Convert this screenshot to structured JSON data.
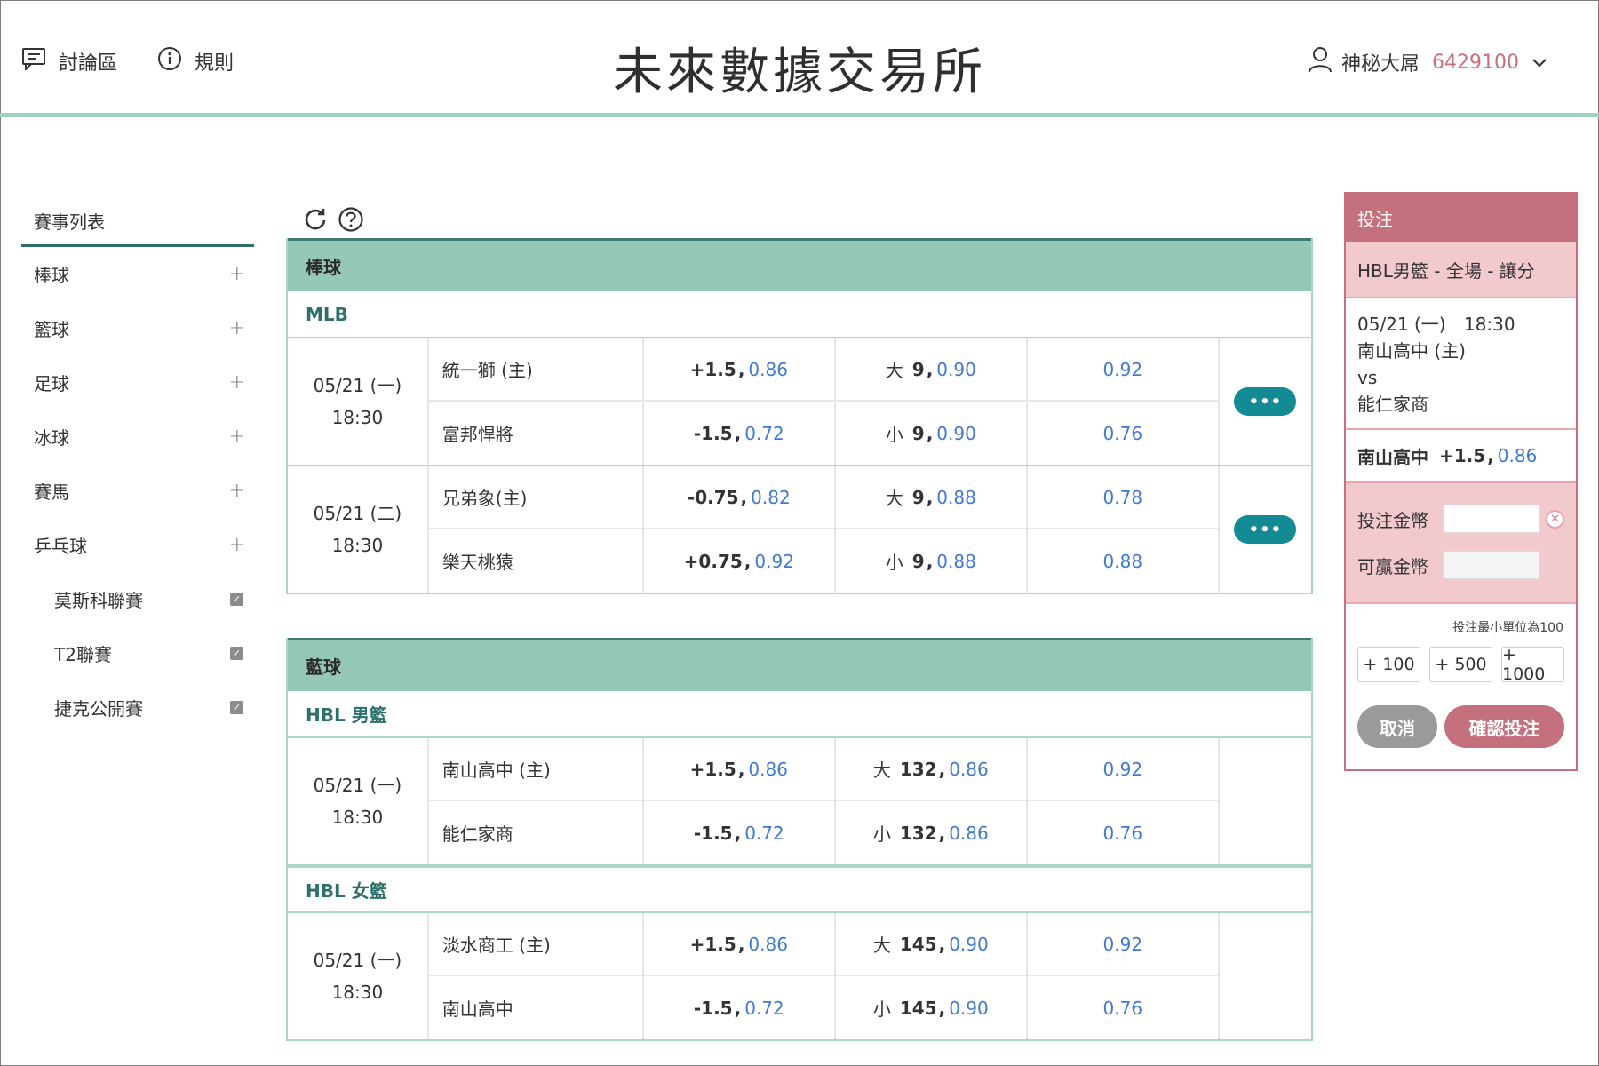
{
  "header": {
    "forum_label": "討論區",
    "rules_label": "規則",
    "site_title": "未來數據交易所",
    "user_name": "神秘大屌",
    "user_balance": "6429100"
  },
  "sidebar": {
    "title": "賽事列表",
    "sports": [
      {
        "label": "棒球",
        "icon": "plus-icon"
      },
      {
        "label": "籃球",
        "icon": "plus-icon"
      },
      {
        "label": "足球",
        "icon": "plus-icon"
      },
      {
        "label": "冰球",
        "icon": "plus-icon"
      },
      {
        "label": "賽馬",
        "icon": "plus-icon"
      },
      {
        "label": "乒乓球",
        "icon": "plus-icon"
      }
    ],
    "sub_items": [
      {
        "label": "莫斯科聯賽",
        "checked": true
      },
      {
        "label": "T2聯賽",
        "checked": true
      },
      {
        "label": "捷克公開賽",
        "checked": true
      }
    ],
    "plus_glyph": "+",
    "check_glyph": "✓"
  },
  "sections": [
    {
      "sport": "棒球",
      "leagues": [
        {
          "name": "MLB",
          "matches": [
            {
              "date": "05/21 (一)",
              "time": "18:30",
              "more": "•••",
              "rows": [
                {
                  "team": "統一獅 (主)",
                  "hc": "+1.5",
                  "hc_odd": "0.86",
                  "ou_label": "大",
                  "ou": "9",
                  "ou_odd": "0.90",
                  "ml": "0.92"
                },
                {
                  "team": "富邦悍將",
                  "hc": "-1.5",
                  "hc_odd": "0.72",
                  "ou_label": "小",
                  "ou": "9",
                  "ou_odd": "0.90",
                  "ml": "0.76"
                }
              ]
            },
            {
              "date": "05/21 (二)",
              "time": "18:30",
              "more": "•••",
              "rows": [
                {
                  "team": "兄弟象(主)",
                  "hc": "-0.75",
                  "hc_odd": "0.82",
                  "ou_label": "大",
                  "ou": "9",
                  "ou_odd": "0.88",
                  "ml": "0.78"
                },
                {
                  "team": "樂天桃猿",
                  "hc": "+0.75",
                  "hc_odd": "0.92",
                  "ou_label": "小",
                  "ou": "9",
                  "ou_odd": "0.88",
                  "ml": "0.88"
                }
              ]
            }
          ]
        }
      ]
    },
    {
      "sport": "藍球",
      "leagues": [
        {
          "name": "HBL 男籃",
          "matches": [
            {
              "date": "05/21 (一)",
              "time": "18:30",
              "rows": [
                {
                  "team": "南山高中 (主)",
                  "hc": "+1.5",
                  "hc_odd": "0.86",
                  "ou_label": "大",
                  "ou": "132",
                  "ou_odd": "0.86",
                  "ml": "0.92"
                },
                {
                  "team": "能仁家商",
                  "hc": "-1.5",
                  "hc_odd": "0.72",
                  "ou_label": "小",
                  "ou": "132",
                  "ou_odd": "0.86",
                  "ml": "0.76"
                }
              ]
            }
          ]
        },
        {
          "name": "HBL 女籃",
          "matches": [
            {
              "date": "05/21 (一)",
              "time": "18:30",
              "rows": [
                {
                  "team": "淡水商工 (主)",
                  "hc": "+1.5",
                  "hc_odd": "0.86",
                  "ou_label": "大",
                  "ou": "145",
                  "ou_odd": "0.90",
                  "ml": "0.92"
                },
                {
                  "team": "南山高中",
                  "hc": "-1.5",
                  "hc_odd": "0.72",
                  "ou_label": "小",
                  "ou": "145",
                  "ou_odd": "0.90",
                  "ml": "0.76"
                }
              ]
            }
          ]
        }
      ]
    }
  ],
  "betslip": {
    "title": "投注",
    "market": "HBL男籃 - 全場 - 讓分",
    "date": "05/21 (一)",
    "time": "18:30",
    "home": "南山高中 (主)",
    "vs": "vs",
    "away": "能仁家商",
    "selection_team": "南山高中",
    "selection_line": "+1.5",
    "selection_odd": "0.86",
    "stake_label": "投注金幣",
    "win_label": "可贏金幣",
    "clear_glyph": "✕",
    "min_hint": "投注最小單位為100",
    "quick": [
      "+ 100",
      "+ 500",
      "+ 1000"
    ],
    "cancel": "取消",
    "confirm": "確認投注"
  },
  "colors": {
    "accent_teal": "#96c8b7",
    "dark_teal": "#2d6f6a",
    "odd_blue": "#3f7ad0",
    "more_button": "#138b95",
    "betslip_red": "#c4717d",
    "betslip_pink": "#f2c9cd",
    "balance": "#c7707e"
  }
}
